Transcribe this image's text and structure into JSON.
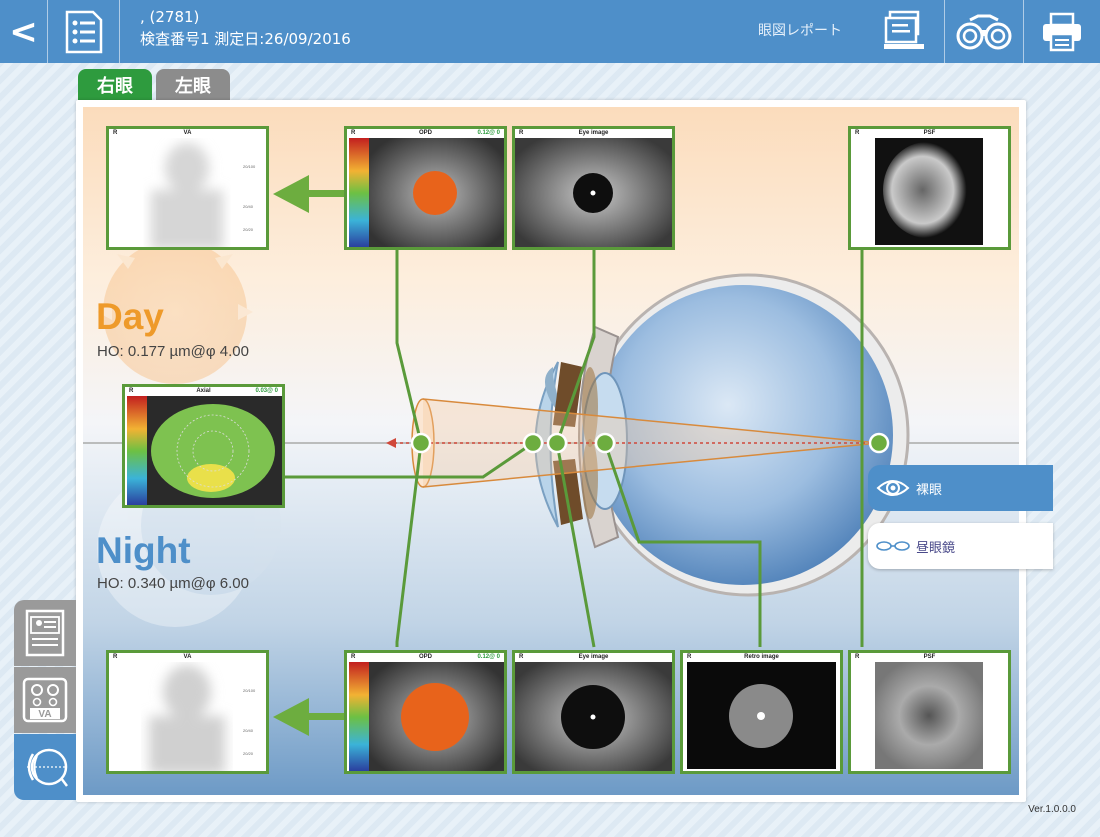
{
  "header": {
    "patient_line": ", (2781)",
    "exam_line": "検査番号1 測定日:26/09/2016",
    "report_title": "眼図レポート",
    "icons": [
      "patient-list-icon",
      "report-icon",
      "refractor-icon",
      "printer-icon"
    ]
  },
  "tabs": {
    "right": "右眼",
    "left": "左眼"
  },
  "day": {
    "label": "Day",
    "ho": "HO: 0.177 µm@φ 4.00"
  },
  "night": {
    "label": "Night",
    "ho": "HO: 0.340 µm@φ 6.00"
  },
  "tiles": {
    "day_va": {
      "eye": "R",
      "title": "VA"
    },
    "day_opd": {
      "eye": "R",
      "title": "OPD",
      "value": "0.12@ 0"
    },
    "day_eye": {
      "eye": "R",
      "title": "Eye image"
    },
    "day_psf": {
      "eye": "R",
      "title": "PSF"
    },
    "axial": {
      "eye": "R",
      "title": "Axial",
      "value": "0.03@ 0"
    },
    "night_va": {
      "eye": "R",
      "title": "VA"
    },
    "night_opd": {
      "eye": "R",
      "title": "OPD",
      "value": "0.12@ 0"
    },
    "night_eye": {
      "eye": "R",
      "title": "Eye image"
    },
    "night_retro": {
      "eye": "R",
      "title": "Retro image"
    },
    "night_psf": {
      "eye": "R",
      "title": "PSF"
    }
  },
  "modes": {
    "naked": "裸眼",
    "glasses": "昼眼鏡"
  },
  "side_buttons": [
    "patient-card-icon",
    "va-chart-icon",
    "eye-anatomy-icon"
  ],
  "side_va_label": "VA",
  "version": "Ver.1.0.0.0",
  "colors": {
    "header_blue": "#4e8fc9",
    "tile_green": "#5a9a3a",
    "day_orange": "#ee9a2a",
    "night_blue": "#4e8fc9"
  }
}
